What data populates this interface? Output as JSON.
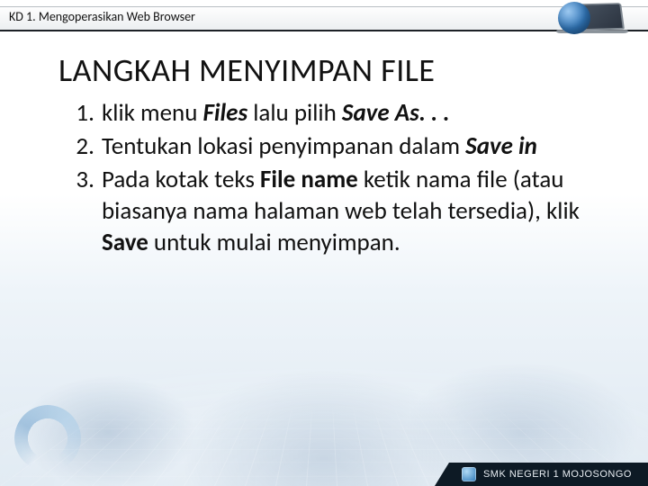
{
  "header": {
    "breadcrumb": "KD 1. Mengoperasikan Web Browser"
  },
  "title": "LANGKAH MENYIMPAN FILE",
  "steps": {
    "s1": {
      "t1": "klik menu ",
      "b1": "Files",
      "t2": " lalu pilih ",
      "b2": "Save As. . ."
    },
    "s2": {
      "t1": "Tentukan lokasi penyimpanan dalam ",
      "b1": "Save in"
    },
    "s3": {
      "t1": "Pada kotak teks ",
      "b1": "File name",
      "t2": " ketik nama file (atau biasanya nama halaman web telah tersedia), klik ",
      "b2": "Save",
      "t3": " untuk mulai menyimpan."
    }
  },
  "footer": {
    "text": "SMK NEGERI 1 MOJOSONGO"
  }
}
